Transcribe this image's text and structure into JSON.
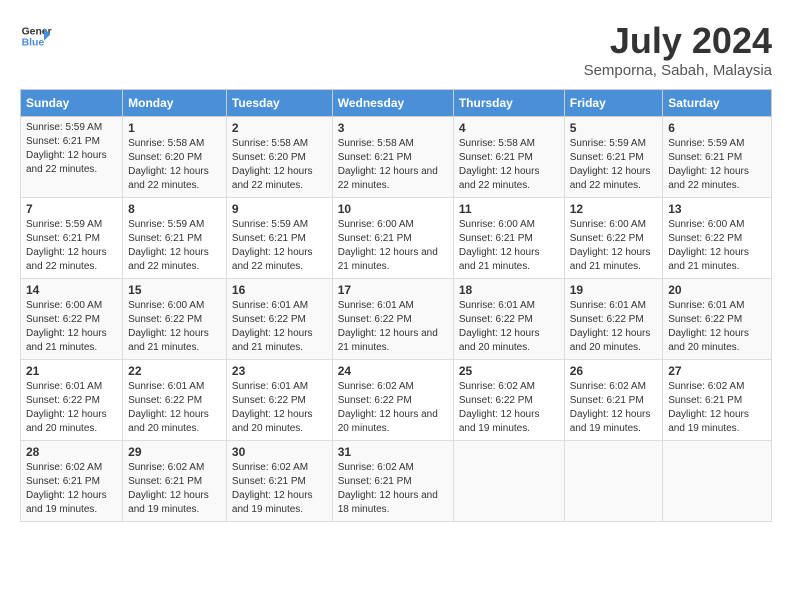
{
  "header": {
    "logo_line1": "General",
    "logo_line2": "Blue",
    "month_title": "July 2024",
    "subtitle": "Semporna, Sabah, Malaysia"
  },
  "days_of_week": [
    "Sunday",
    "Monday",
    "Tuesday",
    "Wednesday",
    "Thursday",
    "Friday",
    "Saturday"
  ],
  "weeks": [
    [
      {
        "day": "",
        "info": ""
      },
      {
        "day": "1",
        "info": "Sunrise: 5:58 AM\nSunset: 6:20 PM\nDaylight: 12 hours\nand 22 minutes."
      },
      {
        "day": "2",
        "info": "Sunrise: 5:58 AM\nSunset: 6:20 PM\nDaylight: 12 hours\nand 22 minutes."
      },
      {
        "day": "3",
        "info": "Sunrise: 5:58 AM\nSunset: 6:21 PM\nDaylight: 12 hours\nand 22 minutes."
      },
      {
        "day": "4",
        "info": "Sunrise: 5:58 AM\nSunset: 6:21 PM\nDaylight: 12 hours\nand 22 minutes."
      },
      {
        "day": "5",
        "info": "Sunrise: 5:59 AM\nSunset: 6:21 PM\nDaylight: 12 hours\nand 22 minutes."
      },
      {
        "day": "6",
        "info": "Sunrise: 5:59 AM\nSunset: 6:21 PM\nDaylight: 12 hours\nand 22 minutes."
      }
    ],
    [
      {
        "day": "7",
        "info": ""
      },
      {
        "day": "8",
        "info": "Sunrise: 5:59 AM\nSunset: 6:21 PM\nDaylight: 12 hours\nand 22 minutes."
      },
      {
        "day": "9",
        "info": "Sunrise: 5:59 AM\nSunset: 6:21 PM\nDaylight: 12 hours\nand 22 minutes."
      },
      {
        "day": "10",
        "info": "Sunrise: 6:00 AM\nSunset: 6:21 PM\nDaylight: 12 hours\nand 21 minutes."
      },
      {
        "day": "11",
        "info": "Sunrise: 6:00 AM\nSunset: 6:21 PM\nDaylight: 12 hours\nand 21 minutes."
      },
      {
        "day": "12",
        "info": "Sunrise: 6:00 AM\nSunset: 6:22 PM\nDaylight: 12 hours\nand 21 minutes."
      },
      {
        "day": "13",
        "info": "Sunrise: 6:00 AM\nSunset: 6:22 PM\nDaylight: 12 hours\nand 21 minutes."
      }
    ],
    [
      {
        "day": "14",
        "info": ""
      },
      {
        "day": "15",
        "info": "Sunrise: 6:00 AM\nSunset: 6:22 PM\nDaylight: 12 hours\nand 21 minutes."
      },
      {
        "day": "16",
        "info": "Sunrise: 6:01 AM\nSunset: 6:22 PM\nDaylight: 12 hours\nand 21 minutes."
      },
      {
        "day": "17",
        "info": "Sunrise: 6:01 AM\nSunset: 6:22 PM\nDaylight: 12 hours\nand 21 minutes."
      },
      {
        "day": "18",
        "info": "Sunrise: 6:01 AM\nSunset: 6:22 PM\nDaylight: 12 hours\nand 20 minutes."
      },
      {
        "day": "19",
        "info": "Sunrise: 6:01 AM\nSunset: 6:22 PM\nDaylight: 12 hours\nand 20 minutes."
      },
      {
        "day": "20",
        "info": "Sunrise: 6:01 AM\nSunset: 6:22 PM\nDaylight: 12 hours\nand 20 minutes."
      }
    ],
    [
      {
        "day": "21",
        "info": ""
      },
      {
        "day": "22",
        "info": "Sunrise: 6:01 AM\nSunset: 6:22 PM\nDaylight: 12 hours\nand 20 minutes."
      },
      {
        "day": "23",
        "info": "Sunrise: 6:01 AM\nSunset: 6:22 PM\nDaylight: 12 hours\nand 20 minutes."
      },
      {
        "day": "24",
        "info": "Sunrise: 6:02 AM\nSunset: 6:22 PM\nDaylight: 12 hours\nand 20 minutes."
      },
      {
        "day": "25",
        "info": "Sunrise: 6:02 AM\nSunset: 6:22 PM\nDaylight: 12 hours\nand 19 minutes."
      },
      {
        "day": "26",
        "info": "Sunrise: 6:02 AM\nSunset: 6:21 PM\nDaylight: 12 hours\nand 19 minutes."
      },
      {
        "day": "27",
        "info": "Sunrise: 6:02 AM\nSunset: 6:21 PM\nDaylight: 12 hours\nand 19 minutes."
      }
    ],
    [
      {
        "day": "28",
        "info": "Sunrise: 6:02 AM\nSunset: 6:21 PM\nDaylight: 12 hours\nand 19 minutes."
      },
      {
        "day": "29",
        "info": "Sunrise: 6:02 AM\nSunset: 6:21 PM\nDaylight: 12 hours\nand 19 minutes."
      },
      {
        "day": "30",
        "info": "Sunrise: 6:02 AM\nSunset: 6:21 PM\nDaylight: 12 hours\nand 19 minutes."
      },
      {
        "day": "31",
        "info": "Sunrise: 6:02 AM\nSunset: 6:21 PM\nDaylight: 12 hours\nand 18 minutes."
      },
      {
        "day": "",
        "info": ""
      },
      {
        "day": "",
        "info": ""
      },
      {
        "day": "",
        "info": ""
      }
    ]
  ],
  "week1_day7_info": "Sunrise: 5:59 AM\nSunset: 6:21 PM\nDaylight: 12 hours\nand 22 minutes.",
  "week2_day14_info": "Sunrise: 6:00 AM\nSunset: 6:22 PM\nDaylight: 12 hours\nand 21 minutes.",
  "week3_day21_info": "Sunrise: 6:01 AM\nSunset: 6:22 PM\nDaylight: 12 hours\nand 20 minutes."
}
